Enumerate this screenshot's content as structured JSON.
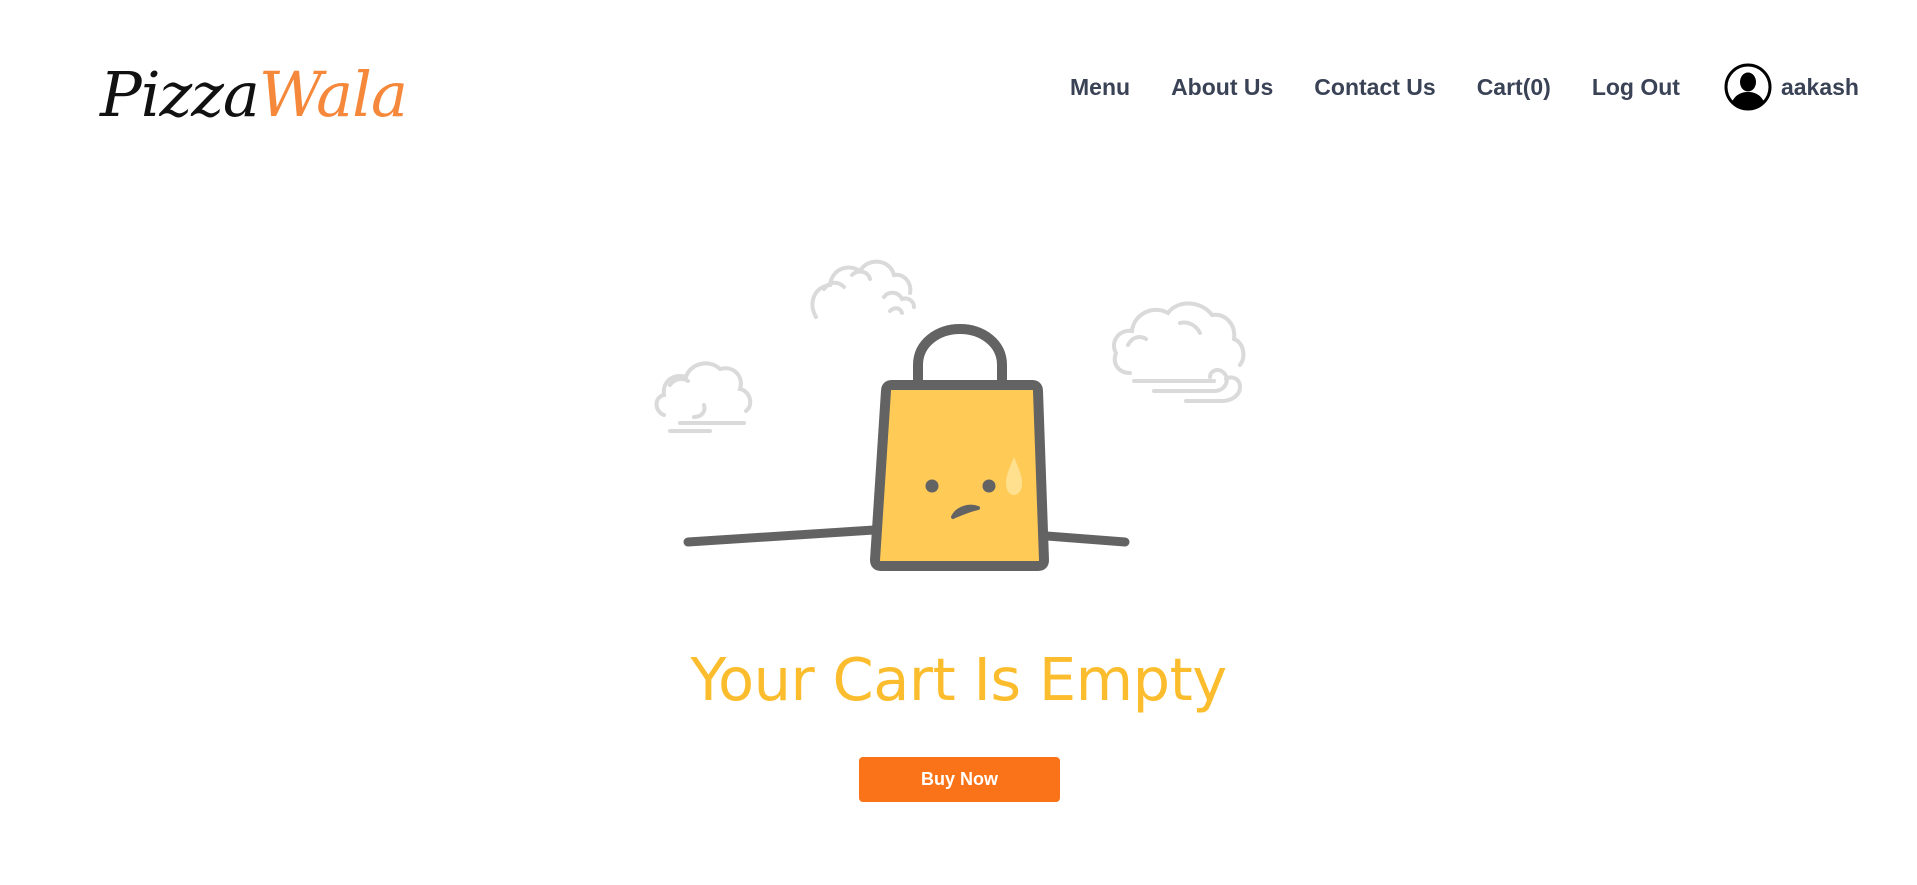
{
  "brand": {
    "part1": "Pizza",
    "part2": "Wala",
    "accent_color": "#f5883a"
  },
  "nav": {
    "items": [
      {
        "label": "Menu"
      },
      {
        "label": "About Us"
      },
      {
        "label": "Contact Us"
      },
      {
        "label": "Cart(0)"
      },
      {
        "label": "Log Out"
      }
    ],
    "user": {
      "icon": "user-avatar-icon",
      "name": "aakash"
    }
  },
  "empty_cart": {
    "illustration": "sad-shopping-bag-icon",
    "title": "Your Cart Is Empty",
    "title_color": "#fbbd2d",
    "button_label": "Buy Now",
    "button_color": "#fb7318"
  }
}
